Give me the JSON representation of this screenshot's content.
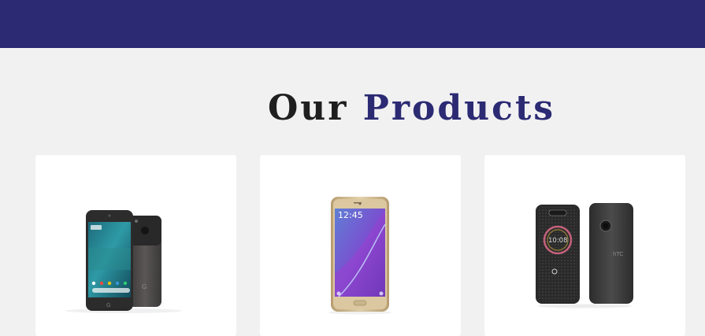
{
  "header": {
    "color": "#2b2a73"
  },
  "products_section": {
    "title_part1": "Our",
    "title_part2": "Products",
    "accent_color": "#2b2a73"
  },
  "products": [
    {
      "image": "google-pixel-phone"
    },
    {
      "image": "samsung-galaxy-note5-phone"
    },
    {
      "image": "htc-10-phone-with-ice-case"
    }
  ]
}
